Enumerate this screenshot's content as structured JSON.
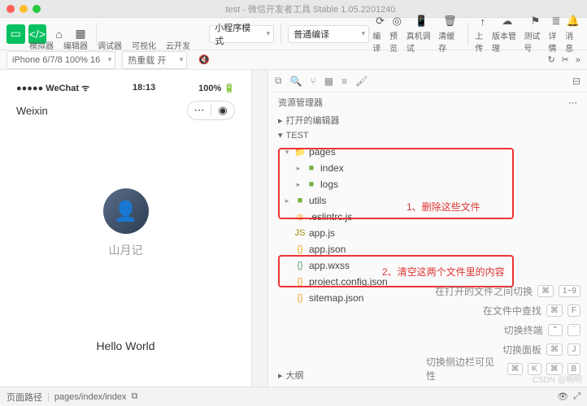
{
  "window": {
    "title": "test - 微信开发者工具 Stable 1.05.2201240"
  },
  "toolbar": {
    "tabs": [
      "模拟器",
      "编辑器",
      "调试器",
      "可视化",
      "云开发"
    ],
    "modeDropdown": "小程序模式",
    "compileDropdown": "普通编译",
    "actions": [
      "编译",
      "预览",
      "真机调试",
      "清缓存"
    ],
    "rightActions": [
      "上传",
      "版本管理",
      "测试号",
      "详情",
      "消息"
    ]
  },
  "subbar": {
    "device": "iPhone 6/7/8 100% 16",
    "hotreload": "热重载 开"
  },
  "phone": {
    "carrier": "●●●●● WeChat",
    "time": "18:13",
    "battery": "100%",
    "navTitle": "Weixin",
    "nickname": "山月记",
    "hello": "Hello World",
    "capsuleMore": "⋯",
    "capsuleClose": "◉"
  },
  "explorer": {
    "title": "资源管理器",
    "openEditors": "打开的编辑器",
    "project": "TEST",
    "tree": [
      {
        "pad": 18,
        "twist": "▾",
        "icon": "📁",
        "cls": "ic-folder-o",
        "label": "pages"
      },
      {
        "pad": 32,
        "twist": "▸",
        "icon": "■",
        "cls": "ic-folder-g",
        "label": "index"
      },
      {
        "pad": 32,
        "twist": "▸",
        "icon": "■",
        "cls": "ic-folder-g",
        "label": "logs"
      },
      {
        "pad": 18,
        "twist": "▸",
        "icon": "■",
        "cls": "ic-folder-g",
        "label": "utils"
      },
      {
        "pad": 18,
        "twist": "",
        "icon": "⊘",
        "cls": "ic-config",
        "label": ".eslintrc.js"
      },
      {
        "pad": 18,
        "twist": "",
        "icon": "JS",
        "cls": "ic-js",
        "label": "app.js"
      },
      {
        "pad": 18,
        "twist": "",
        "icon": "{}",
        "cls": "ic-json",
        "label": "app.json"
      },
      {
        "pad": 18,
        "twist": "",
        "icon": "{}",
        "cls": "ic-css",
        "label": "app.wxss"
      },
      {
        "pad": 18,
        "twist": "",
        "icon": "{}",
        "cls": "ic-json",
        "label": "project.config.json"
      },
      {
        "pad": 18,
        "twist": "",
        "icon": "{}",
        "cls": "ic-json",
        "label": "sitemap.json"
      }
    ],
    "outline": "大纲",
    "annotation1": "1、删除这些文件",
    "annotation2": "2、清空这两个文件里的内容"
  },
  "hints": [
    {
      "label": "在打开的文件之间切换",
      "keys": [
        "⌘",
        "1~9"
      ]
    },
    {
      "label": "在文件中查找",
      "keys": [
        "⌘",
        "F"
      ]
    },
    {
      "label": "切换终端",
      "keys": [
        "⌃",
        "`"
      ]
    },
    {
      "label": "切换面板",
      "keys": [
        "⌘",
        "J"
      ]
    },
    {
      "label": "切换侧边栏可见性",
      "keys": [
        "⌘",
        "K",
        "⌘",
        "B"
      ]
    }
  ],
  "footer": {
    "pathLabel": "页面路径",
    "path": "pages/index/index"
  },
  "watermark": "CSDN @明明"
}
